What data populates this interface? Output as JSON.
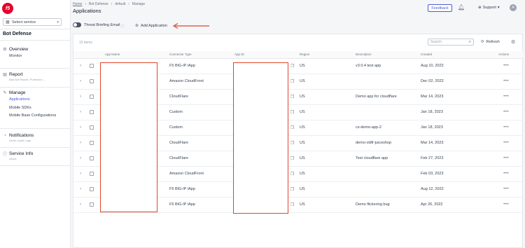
{
  "sidebar": {
    "logo_text": "f5",
    "service_select": {
      "placeholder": "Select service"
    },
    "product_title": "Bot Defense",
    "sections": [
      {
        "label": "Overview",
        "icon": "overview-icon",
        "items": [
          "Monitor"
        ]
      },
      {
        "label": "Report",
        "icon": "report-icon",
        "subtitle": "Bad Bot Report, Protection ..."
      },
      {
        "label": "Manage",
        "icon": "manage-icon",
        "items": [
          "Applications",
          "Mobile SDKs",
          "Mobile Base Configurations"
        ]
      },
      {
        "label": "Notifications",
        "icon": "bell-icon",
        "subtitle": "Alerts, Audit Logs"
      },
      {
        "label": "Service Info",
        "icon": "info-icon",
        "subtitle": "About"
      }
    ]
  },
  "header": {
    "breadcrumb": [
      "Home",
      "Bot Defense",
      "default",
      "Manage"
    ],
    "title": "Applications",
    "feedback_label": "Feedback",
    "support_label": "Support",
    "avatar_initial": "A"
  },
  "toolbar": {
    "toggle_label": "Threat Briefing Email",
    "add_label": "Add Application"
  },
  "table": {
    "count_label": "15 items",
    "search_placeholder": "Search",
    "refresh_label": "Refresh",
    "columns": [
      "App Name",
      "Connector Type",
      "App ID",
      "Region",
      "Description",
      "Created",
      "Actions"
    ],
    "rows": [
      {
        "connector": "F5 BIG-IP iApp",
        "region": "US",
        "description": "v3.0.4 test app",
        "created": "Aug 10, 2022"
      },
      {
        "connector": "Amazon CloudFront",
        "region": "US",
        "description": "",
        "created": "Dec 02, 2022"
      },
      {
        "connector": "CloudFlare",
        "region": "US",
        "description": "Demo app for cloudflare",
        "created": "Mar 14, 2023"
      },
      {
        "connector": "Custom",
        "region": "US",
        "description": "",
        "created": "Jan 18, 2023"
      },
      {
        "connector": "Custom",
        "region": "US",
        "description": "cs-demo-app-2",
        "created": "Jan 18, 2023"
      },
      {
        "connector": "CloudFlare",
        "region": "US",
        "description": "demo-cldfr-juiceshop",
        "created": "Mar 14, 2023"
      },
      {
        "connector": "CloudFlare",
        "region": "US",
        "description": "Test cloudflare app",
        "created": "Feb 27, 2023"
      },
      {
        "connector": "Amazon CloudFront",
        "region": "US",
        "description": "",
        "created": "Feb 03, 2023"
      },
      {
        "connector": "F5 BIG-IP iApp",
        "region": "US",
        "description": "",
        "created": "Aug 12, 2022"
      },
      {
        "connector": "F5 BIG-IP iApp",
        "region": "US",
        "description": "Demo flickering bug",
        "created": "Apr 26, 2022"
      }
    ]
  },
  "colors": {
    "accent": "#4f5bd5",
    "redaction": "#e0452a",
    "brand": "#e4002b"
  }
}
